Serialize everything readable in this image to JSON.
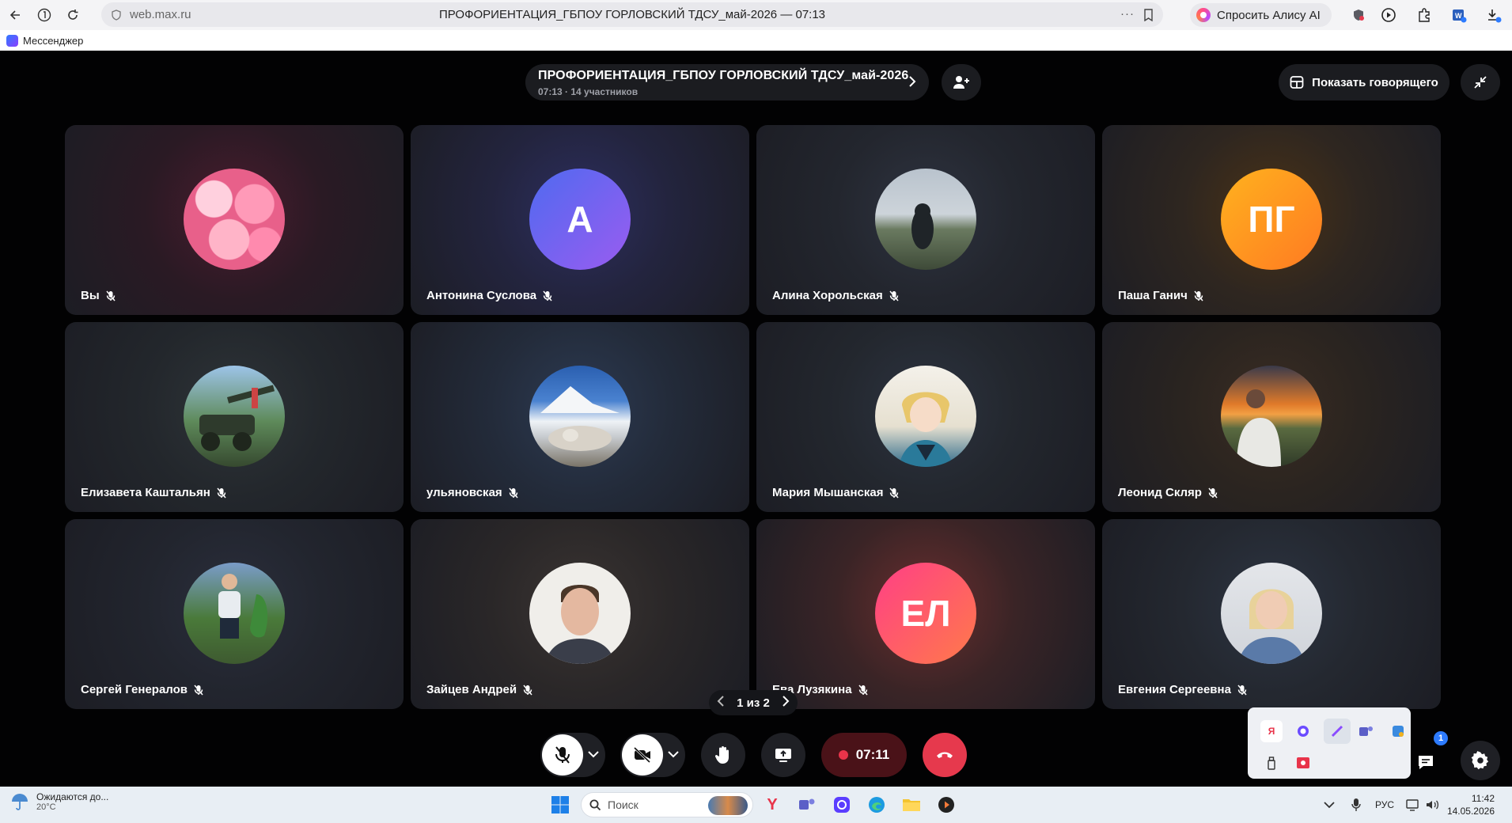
{
  "browser": {
    "url": "web.max.ru",
    "page_title": "ПРОФОРИЕНТАЦИЯ_ГБПОУ ГОРЛОВСКИЙ ТДСУ_май-2026 — 07:13",
    "alice_label": "Спросить Алису AI",
    "more_icon": "···",
    "bookmark": "Мессенджер"
  },
  "call": {
    "title": "ПРОФОРИЕНТАЦИЯ_ГБПОУ ГОРЛОВСКИЙ ТДСУ_май-2026",
    "subtitle": "07:13 · 14 участников",
    "show_speaker_label": "Показать говорящего",
    "pager": "1 из 2",
    "timer": "07:11",
    "chat_badge": "1"
  },
  "participants": [
    {
      "name": "Вы",
      "initials": "",
      "avatar": "roses-photo",
      "muted": true
    },
    {
      "name": "Антонина Суслова",
      "initials": "А",
      "avatar": "initials",
      "colors": [
        "#4f6af0",
        "#9a5cf0"
      ],
      "muted": true
    },
    {
      "name": "Алина Хорольская",
      "initials": "",
      "avatar": "landscape-photo",
      "muted": true
    },
    {
      "name": "Паша Ганич",
      "initials": "ПГ",
      "avatar": "initials",
      "colors": [
        "#ffb21e",
        "#ff7a22"
      ],
      "muted": true
    },
    {
      "name": "Елизавета Каштальян",
      "initials": "",
      "avatar": "monument-photo",
      "muted": true
    },
    {
      "name": "ульяновская",
      "initials": "",
      "avatar": "mountain-cat-photo",
      "muted": true
    },
    {
      "name": "Мария Мышанская",
      "initials": "",
      "avatar": "anime-photo",
      "muted": true
    },
    {
      "name": "Леонид Скляр",
      "initials": "",
      "avatar": "sunset-photo",
      "muted": true
    },
    {
      "name": "Сергей Генералов",
      "initials": "",
      "avatar": "park-photo",
      "muted": true
    },
    {
      "name": "Зайцев Андрей",
      "initials": "",
      "avatar": "portrait-photo",
      "muted": true
    },
    {
      "name": "Ева Лузякина",
      "initials": "ЕЛ",
      "avatar": "initials",
      "colors": [
        "#ff3f86",
        "#ff7a4a"
      ],
      "muted": true
    },
    {
      "name": "Евгения Сергеевна",
      "initials": "",
      "avatar": "woman-photo",
      "muted": true
    }
  ],
  "taskbar": {
    "weather_text": "Ожидаются до...",
    "temperature": "20°C",
    "search_placeholder": "Поиск",
    "language": "РУС",
    "time": "11:42",
    "date": "14.05.2026"
  },
  "colors": {
    "accent": "#2d7bff",
    "hangup": "#e6394d",
    "timer_bg": "#4a1218"
  }
}
